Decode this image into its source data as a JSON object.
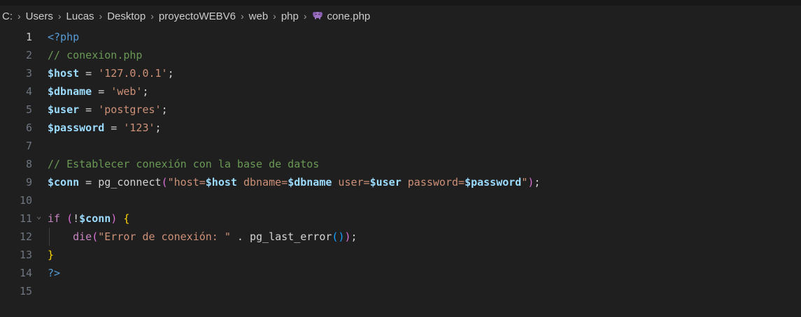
{
  "breadcrumb": {
    "items": [
      "C:",
      "Users",
      "Lucas",
      "Desktop",
      "proyectoWEBV6",
      "web",
      "php",
      "cone.php"
    ],
    "separator": "›",
    "file_icon": "php-elephant-icon"
  },
  "editor": {
    "active_line": 1,
    "line_numbers": [
      "1",
      "2",
      "3",
      "4",
      "5",
      "6",
      "7",
      "8",
      "9",
      "10",
      "11",
      "12",
      "13",
      "14",
      "15"
    ],
    "lines": [
      [
        {
          "t": "<?php",
          "k": "tag"
        }
      ],
      [
        {
          "t": "// conexion.php",
          "k": "comment"
        }
      ],
      [
        {
          "t": "$host",
          "k": "var"
        },
        {
          "t": " = ",
          "k": "op"
        },
        {
          "t": "'127.0.0.1'",
          "k": "str"
        },
        {
          "t": ";",
          "k": "op"
        }
      ],
      [
        {
          "t": "$dbname",
          "k": "var"
        },
        {
          "t": " = ",
          "k": "op"
        },
        {
          "t": "'web'",
          "k": "str"
        },
        {
          "t": ";",
          "k": "op"
        }
      ],
      [
        {
          "t": "$user",
          "k": "var"
        },
        {
          "t": " = ",
          "k": "op"
        },
        {
          "t": "'postgres'",
          "k": "str"
        },
        {
          "t": ";",
          "k": "op"
        }
      ],
      [
        {
          "t": "$password",
          "k": "var"
        },
        {
          "t": " = ",
          "k": "op"
        },
        {
          "t": "'123'",
          "k": "str"
        },
        {
          "t": ";",
          "k": "op"
        }
      ],
      [],
      [
        {
          "t": "// Establecer conexión con la base de datos",
          "k": "comment"
        }
      ],
      [
        {
          "t": "$conn",
          "k": "var"
        },
        {
          "t": " = ",
          "k": "op"
        },
        {
          "t": "pg_connect",
          "k": "op"
        },
        {
          "t": "(",
          "k": "paren2"
        },
        {
          "t": "\"host=",
          "k": "str"
        },
        {
          "t": "$host",
          "k": "var"
        },
        {
          "t": " dbname=",
          "k": "str"
        },
        {
          "t": "$dbname",
          "k": "var"
        },
        {
          "t": " user=",
          "k": "str"
        },
        {
          "t": "$user",
          "k": "var"
        },
        {
          "t": " password=",
          "k": "str"
        },
        {
          "t": "$password",
          "k": "var"
        },
        {
          "t": "\"",
          "k": "str"
        },
        {
          "t": ")",
          "k": "paren2"
        },
        {
          "t": ";",
          "k": "op"
        }
      ],
      [],
      [
        {
          "t": "if",
          "k": "kw"
        },
        {
          "t": " ",
          "k": "op"
        },
        {
          "t": "(",
          "k": "paren2"
        },
        {
          "t": "!",
          "k": "op"
        },
        {
          "t": "$conn",
          "k": "var"
        },
        {
          "t": ")",
          "k": "paren2"
        },
        {
          "t": " ",
          "k": "op"
        },
        {
          "t": "{",
          "k": "brace"
        }
      ],
      [
        {
          "t": "    ",
          "k": "op"
        },
        {
          "t": "die",
          "k": "kw"
        },
        {
          "t": "(",
          "k": "paren2"
        },
        {
          "t": "\"Error de conexión: \"",
          "k": "str"
        },
        {
          "t": " . ",
          "k": "op"
        },
        {
          "t": "pg_last_error",
          "k": "op"
        },
        {
          "t": "(",
          "k": "paren3"
        },
        {
          "t": ")",
          "k": "paren3"
        },
        {
          "t": ")",
          "k": "paren2"
        },
        {
          "t": ";",
          "k": "op"
        }
      ],
      [
        {
          "t": "}",
          "k": "brace"
        }
      ],
      [
        {
          "t": "?>",
          "k": "tag"
        }
      ],
      []
    ]
  }
}
